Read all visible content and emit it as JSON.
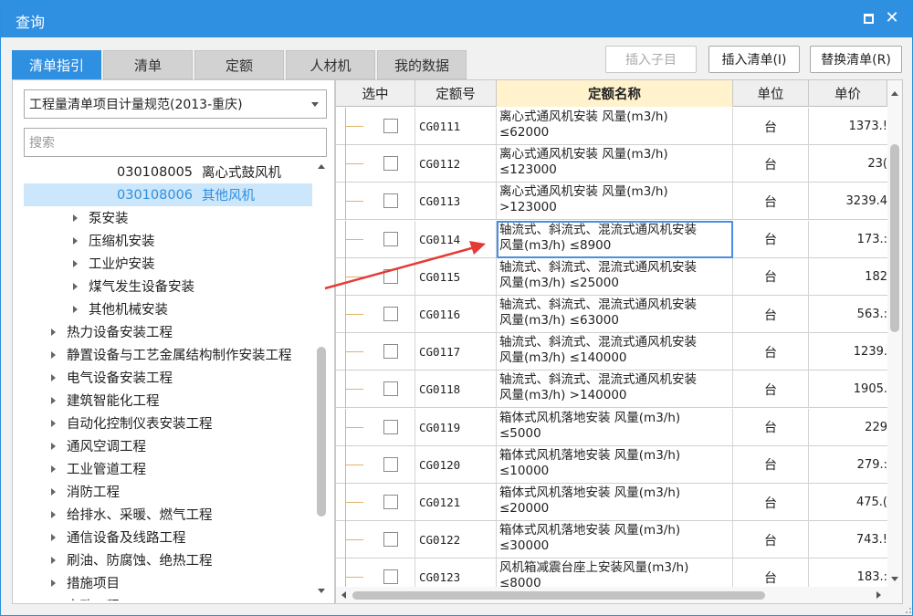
{
  "window": {
    "title": "查询"
  },
  "tabs": [
    {
      "label": "清单指引",
      "active": true
    },
    {
      "label": "清单",
      "active": false
    },
    {
      "label": "定额",
      "active": false
    },
    {
      "label": "人材机",
      "active": false
    },
    {
      "label": "我的数据",
      "active": false
    }
  ],
  "toolbar": {
    "insert_child_label": "插入子目",
    "insert_list_label": "插入清单(I)",
    "replace_list_label": "替换清单(R)"
  },
  "left": {
    "spec_select_value": "工程量清单项目计量规范(2013-重庆)",
    "search_placeholder": "搜索",
    "tree": [
      {
        "code": "030108005",
        "label": "离心式鼓风机",
        "level": 3,
        "arrow": false,
        "selected": false
      },
      {
        "code": "030108006",
        "label": "其他风机",
        "level": 3,
        "arrow": false,
        "selected": true
      },
      {
        "code": "",
        "label": "泵安装",
        "level": 2,
        "arrow": true,
        "selected": false
      },
      {
        "code": "",
        "label": "压缩机安装",
        "level": 2,
        "arrow": true,
        "selected": false
      },
      {
        "code": "",
        "label": "工业炉安装",
        "level": 2,
        "arrow": true,
        "selected": false
      },
      {
        "code": "",
        "label": "煤气发生设备安装",
        "level": 2,
        "arrow": true,
        "selected": false
      },
      {
        "code": "",
        "label": "其他机械安装",
        "level": 2,
        "arrow": true,
        "selected": false
      },
      {
        "code": "",
        "label": "热力设备安装工程",
        "level": 1,
        "arrow": true,
        "selected": false
      },
      {
        "code": "",
        "label": "静置设备与工艺金属结构制作安装工程",
        "level": 1,
        "arrow": true,
        "selected": false
      },
      {
        "code": "",
        "label": "电气设备安装工程",
        "level": 1,
        "arrow": true,
        "selected": false
      },
      {
        "code": "",
        "label": "建筑智能化工程",
        "level": 1,
        "arrow": true,
        "selected": false
      },
      {
        "code": "",
        "label": "自动化控制仪表安装工程",
        "level": 1,
        "arrow": true,
        "selected": false
      },
      {
        "code": "",
        "label": "通风空调工程",
        "level": 1,
        "arrow": true,
        "selected": false
      },
      {
        "code": "",
        "label": "工业管道工程",
        "level": 1,
        "arrow": true,
        "selected": false
      },
      {
        "code": "",
        "label": "消防工程",
        "level": 1,
        "arrow": true,
        "selected": false
      },
      {
        "code": "",
        "label": "给排水、采暖、燃气工程",
        "level": 1,
        "arrow": true,
        "selected": false
      },
      {
        "code": "",
        "label": "通信设备及线路工程",
        "level": 1,
        "arrow": true,
        "selected": false
      },
      {
        "code": "",
        "label": "刷油、防腐蚀、绝热工程",
        "level": 1,
        "arrow": true,
        "selected": false
      },
      {
        "code": "",
        "label": "措施项目",
        "level": 1,
        "arrow": true,
        "selected": false
      },
      {
        "code": "",
        "label": "市政工程",
        "level": 0,
        "arrow": true,
        "selected": false
      }
    ]
  },
  "grid": {
    "headers": {
      "select": "选中",
      "code": "定额号",
      "name": "定额名称",
      "unit": "单位",
      "price": "单价"
    },
    "rows": [
      {
        "code": "CG0111",
        "name1": "离心式通风机安装 风量(m3/h)",
        "name2": "≤62000",
        "unit": "台",
        "price": "1373.!"
      },
      {
        "code": "CG0112",
        "name1": "离心式通风机安装 风量(m3/h)",
        "name2": "≤123000",
        "unit": "台",
        "price": "23("
      },
      {
        "code": "CG0113",
        "name1": "离心式通风机安装 风量(m3/h)",
        "name2": ">123000",
        "unit": "台",
        "price": "3239.4"
      },
      {
        "code": "CG0114",
        "name1": "轴流式、斜流式、混流式通风机安装",
        "name2": "风量(m3/h) ≤8900",
        "unit": "台",
        "price": "173.:"
      },
      {
        "code": "CG0115",
        "name1": "轴流式、斜流式、混流式通风机安装",
        "name2": "风量(m3/h) ≤25000",
        "unit": "台",
        "price": "182"
      },
      {
        "code": "CG0116",
        "name1": "轴流式、斜流式、混流式通风机安装",
        "name2": "风量(m3/h) ≤63000",
        "unit": "台",
        "price": "563.:"
      },
      {
        "code": "CG0117",
        "name1": "轴流式、斜流式、混流式通风机安装",
        "name2": "风量(m3/h) ≤140000",
        "unit": "台",
        "price": "1239."
      },
      {
        "code": "CG0118",
        "name1": "轴流式、斜流式、混流式通风机安装",
        "name2": "风量(m3/h) >140000",
        "unit": "台",
        "price": "1905."
      },
      {
        "code": "CG0119",
        "name1": "箱体式风机落地安装 风量(m3/h)",
        "name2": "≤5000",
        "unit": "台",
        "price": "229"
      },
      {
        "code": "CG0120",
        "name1": "箱体式风机落地安装 风量(m3/h)",
        "name2": "≤10000",
        "unit": "台",
        "price": "279.:"
      },
      {
        "code": "CG0121",
        "name1": "箱体式风机落地安装 风量(m3/h)",
        "name2": "≤20000",
        "unit": "台",
        "price": "475.("
      },
      {
        "code": "CG0122",
        "name1": "箱体式风机落地安装 风量(m3/h)",
        "name2": "≤30000",
        "unit": "台",
        "price": "743.!"
      },
      {
        "code": "CG0123",
        "name1": "风机箱减震台座上安装风量(m3/h)",
        "name2": "≤8000",
        "unit": "台",
        "price": "183.:"
      }
    ],
    "selected_row_index": 3
  },
  "colors": {
    "accent": "#2f8fe0",
    "annotation_arrow": "#e53935"
  }
}
